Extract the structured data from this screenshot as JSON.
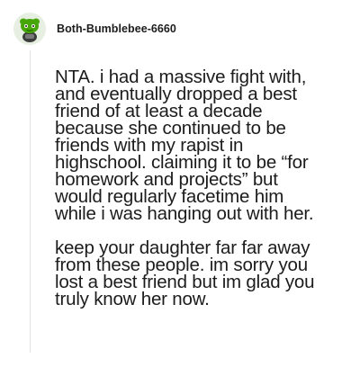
{
  "comment": {
    "author": {
      "username": "Both-Bumblebee-6660",
      "avatar_icon": "snoo-avatar-icon"
    },
    "paragraphs": [
      "NTA. i had a massive fight with,\nand eventually dropped a best\nfriend of at least a decade\nbecause she continued to be\nfriends with my rapist in\nhighschool. claiming it to be “for\nhomework and projects” but\nwould regularly facetime him\nwhile i was hanging out with her.",
      "keep your daughter far far away\nfrom these people. im sorry you\nlost a best friend but im glad you\ntruly know her now."
    ]
  },
  "colors": {
    "text": "#1c1c1c",
    "thread_line": "#e1e3e5",
    "avatar_bg": "#e6efe1",
    "avatar_accent": "#46a508"
  }
}
